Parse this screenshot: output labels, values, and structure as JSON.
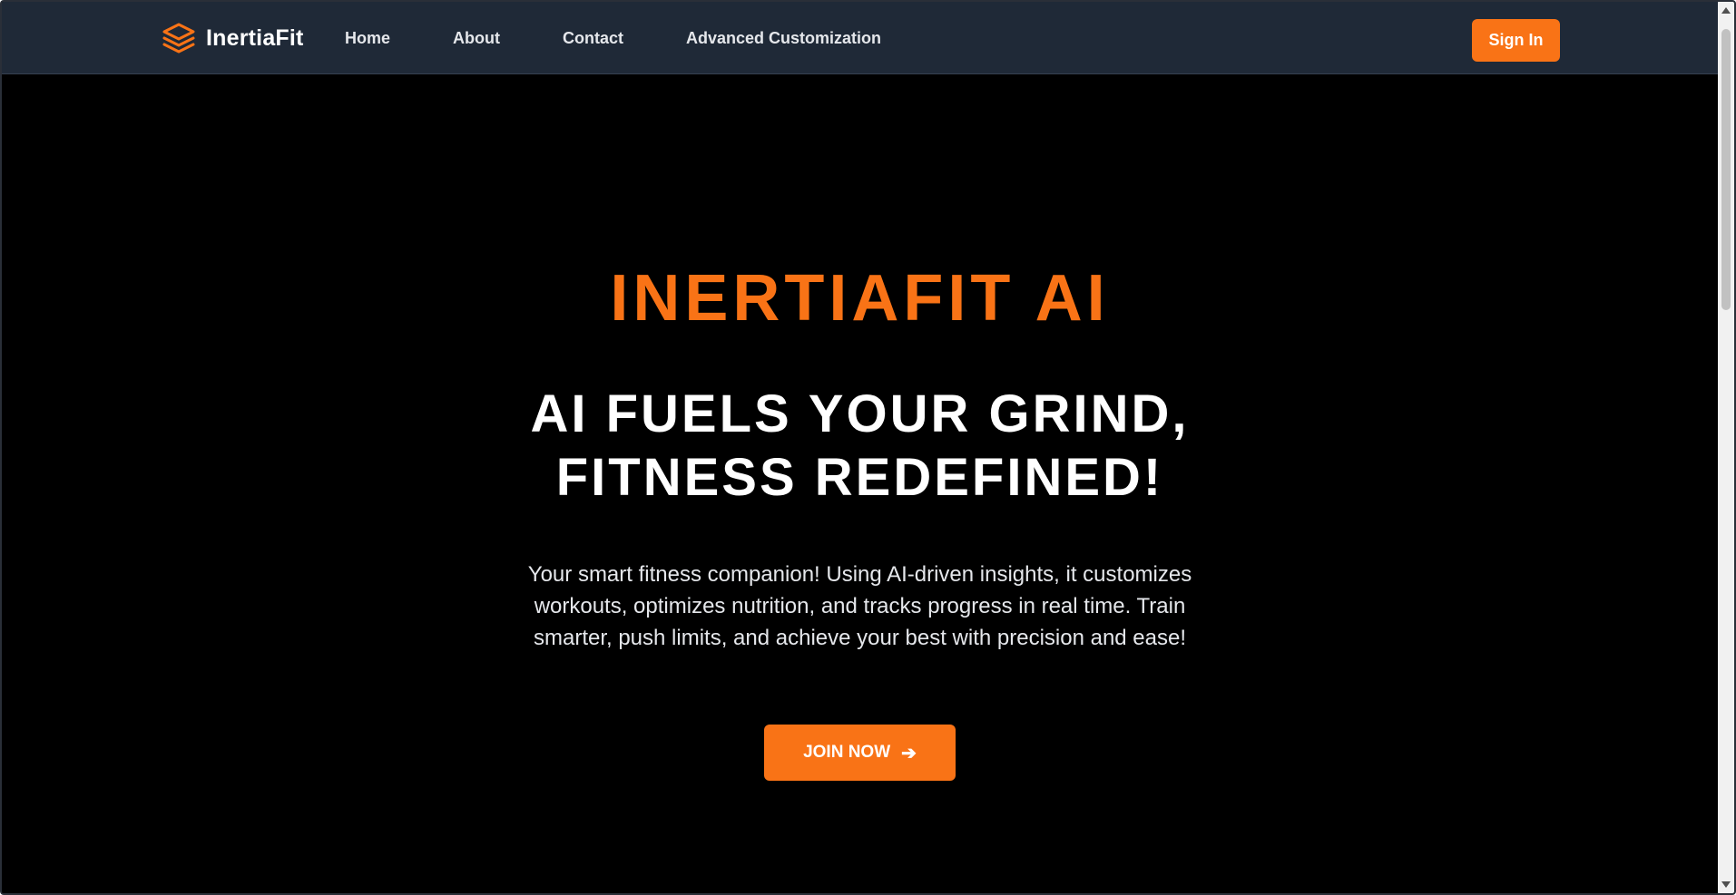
{
  "navbar": {
    "brand": "InertiaFit",
    "brand_icon": "layers-icon",
    "links": [
      "Home",
      "About",
      "Contact",
      "Advanced Customization"
    ],
    "signin_label": "Sign In"
  },
  "hero": {
    "brand_title": "INERTIAFIT AI",
    "headline_line1": "AI FUELS YOUR GRIND,",
    "headline_line2": "FITNESS REDEFINED!",
    "description": "Your smart fitness companion! Using AI-driven insights, it customizes workouts, optimizes nutrition, and tracks progress in real time. Train smarter, push limits, and achieve your best with precision and ease!",
    "join_label": "JOIN NOW",
    "join_icon": "arrow-right-icon"
  },
  "colors": {
    "accent": "#f97316",
    "nav_bg": "#1f2937",
    "hero_bg": "#000000",
    "text_light": "#e5e7eb"
  }
}
